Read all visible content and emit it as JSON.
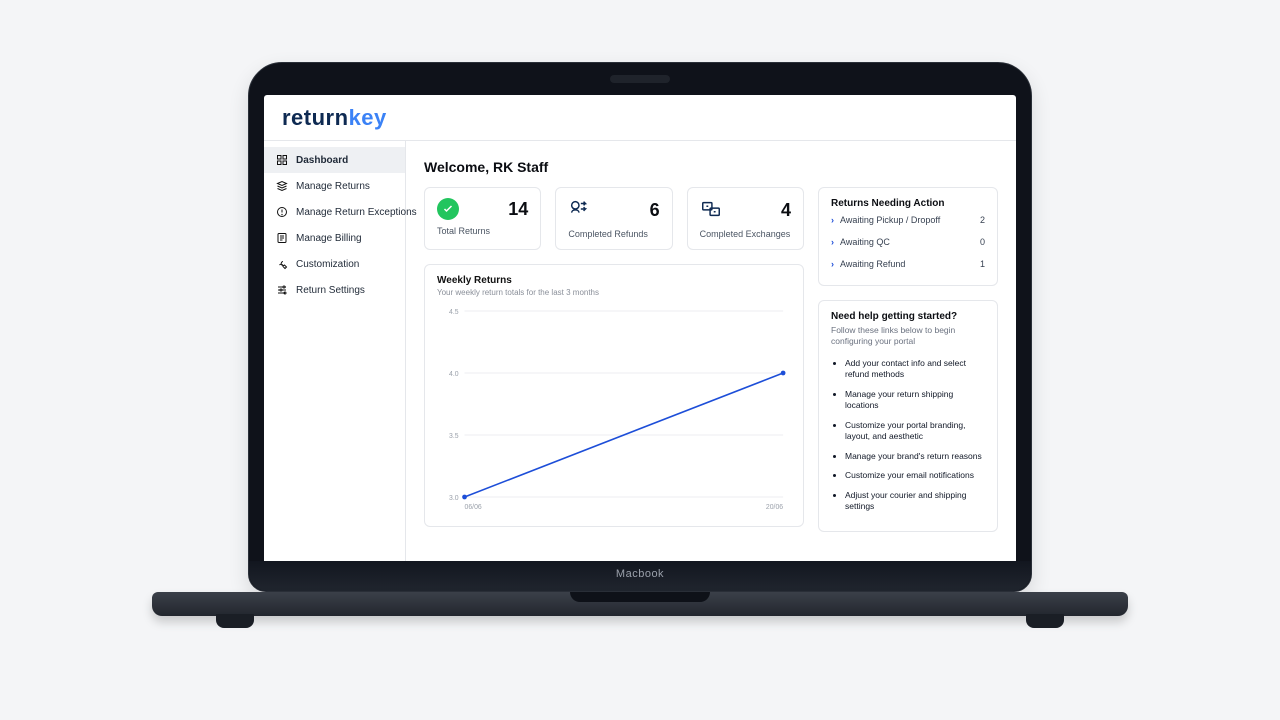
{
  "brand": {
    "part1": "return",
    "part2": "key"
  },
  "sidebar": {
    "items": [
      {
        "label": "Dashboard",
        "icon": "grid-icon",
        "active": true
      },
      {
        "label": "Manage Returns",
        "icon": "returns-icon",
        "active": false
      },
      {
        "label": "Manage Return Exceptions",
        "icon": "exceptions-icon",
        "active": false
      },
      {
        "label": "Manage Billing",
        "icon": "billing-icon",
        "active": false
      },
      {
        "label": "Customization",
        "icon": "wrench-icon",
        "active": false
      },
      {
        "label": "Return Settings",
        "icon": "sliders-icon",
        "active": false
      }
    ]
  },
  "header": {
    "welcome": "Welcome, RK Staff"
  },
  "stats": [
    {
      "label": "Total Returns",
      "value": "14",
      "icon": "check-circle-icon"
    },
    {
      "label": "Completed Refunds",
      "value": "6",
      "icon": "refund-icon"
    },
    {
      "label": "Completed Exchanges",
      "value": "4",
      "icon": "exchange-icon"
    }
  ],
  "actions": {
    "title": "Returns Needing Action",
    "items": [
      {
        "label": "Awaiting Pickup / Dropoff",
        "count": "2"
      },
      {
        "label": "Awaiting QC",
        "count": "0"
      },
      {
        "label": "Awaiting Refund",
        "count": "1"
      }
    ]
  },
  "help": {
    "title": "Need help getting started?",
    "subtitle": "Follow these links below to begin configuring your portal",
    "items": [
      "Add your contact info and select refund methods",
      "Manage your return shipping locations",
      "Customize your portal branding, layout, and aesthetic",
      "Manage your brand's return reasons",
      "Customize your email notifications",
      "Adjust your courier and shipping settings"
    ]
  },
  "chart": {
    "title": "Weekly Returns",
    "subtitle": "Your weekly return totals for the last 3 months"
  },
  "chart_data": {
    "type": "line",
    "x_labels": [
      "06/06",
      "20/06"
    ],
    "x": [
      0,
      1
    ],
    "series": [
      {
        "name": "Weekly Returns",
        "values": [
          3.0,
          4.0
        ],
        "color": "#1d4ed8"
      }
    ],
    "y_ticks": [
      3.0,
      3.5,
      4.0,
      4.5
    ],
    "ylim": [
      3.0,
      4.5
    ],
    "xlabel": "",
    "ylabel": "",
    "grid": true,
    "legend": false
  },
  "laptop": {
    "label": "Macbook"
  }
}
